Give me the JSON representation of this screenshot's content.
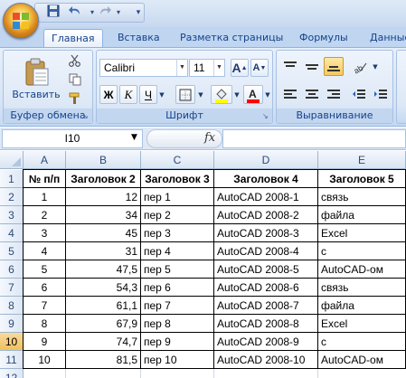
{
  "quick_access": {
    "icons": [
      "save-icon",
      "undo-icon",
      "redo-icon",
      "customize-icon"
    ]
  },
  "tabs": [
    "Главная",
    "Вставка",
    "Разметка страницы",
    "Формулы",
    "Данные"
  ],
  "ribbon": {
    "clipboard": {
      "paste_label": "Вставить",
      "group_label": "Буфер обмена"
    },
    "font": {
      "font_name": "Calibri",
      "font_size": "11",
      "bold": "Ж",
      "italic": "К",
      "underline": "Ч",
      "grow": "A",
      "shrink": "A",
      "group_label": "Шрифт",
      "fill_color": "#ffff00",
      "font_color": "#ff0000"
    },
    "alignment": {
      "group_label": "Выравнивание"
    }
  },
  "formula_bar": {
    "name_box": "I10",
    "fx": "fx",
    "formula": ""
  },
  "sheet": {
    "columns": [
      "A",
      "B",
      "C",
      "D",
      "E"
    ],
    "row_numbers": [
      "1",
      "2",
      "3",
      "4",
      "5",
      "6",
      "7",
      "8",
      "9",
      "10",
      "11",
      "12"
    ],
    "selected_row": "10",
    "headers": [
      "№ п/п",
      "Заголовок 2",
      "Заголовок 3",
      "Заголовок 4",
      "Заголовок 5"
    ],
    "rows": [
      [
        "1",
        "12",
        "пер 1",
        "AutoCAD 2008-1",
        "связь"
      ],
      [
        "2",
        "34",
        "пер 2",
        "AutoCAD 2008-2",
        "файла"
      ],
      [
        "3",
        "45",
        "пер 3",
        "AutoCAD 2008-3",
        "Excel"
      ],
      [
        "4",
        "31",
        "пер 4",
        "AutoCAD 2008-4",
        "с"
      ],
      [
        "5",
        "47,5",
        "пер 5",
        "AutoCAD 2008-5",
        "AutoCAD-ом"
      ],
      [
        "6",
        "54,3",
        "пер 6",
        "AutoCAD 2008-6",
        "связь"
      ],
      [
        "7",
        "61,1",
        "пер 7",
        "AutoCAD 2008-7",
        "файла"
      ],
      [
        "8",
        "67,9",
        "пер 8",
        "AutoCAD 2008-8",
        "Excel"
      ],
      [
        "9",
        "74,7",
        "пер 9",
        "AutoCAD 2008-9",
        "с"
      ],
      [
        "10",
        "81,5",
        "пер 10",
        "AutoCAD 2008-10",
        "AutoCAD-ом"
      ]
    ]
  }
}
